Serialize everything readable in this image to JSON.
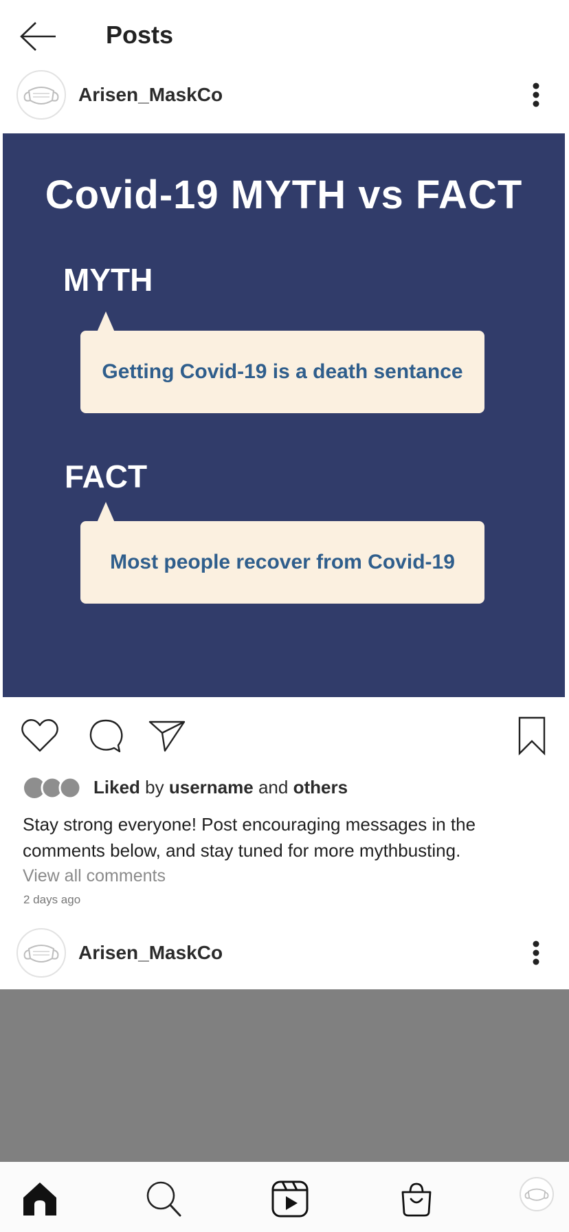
{
  "header": {
    "title": "Posts",
    "back_icon": "arrow-left-icon"
  },
  "post1": {
    "username": "Arisen_MaskCo",
    "avatar_icon": "face-mask-icon",
    "more_icon": "more-vertical-icon",
    "image": {
      "title": "Covid-19 MYTH vs FACT",
      "myth_label": "MYTH",
      "myth_text": "Getting Covid-19 is a death sentance",
      "fact_label": "FACT",
      "fact_text": "Most people recover from Covid-19",
      "background_color": "#313c6a",
      "bubble_color": "#fbf0e0",
      "bubble_text_color": "#2f5e8c"
    },
    "actions": {
      "like_icon": "heart-icon",
      "comment_icon": "comment-icon",
      "share_icon": "send-icon",
      "save_icon": "bookmark-icon"
    },
    "likes": {
      "liked": "Liked",
      "by": "by",
      "username": "username",
      "and": "and",
      "others": "others"
    },
    "caption": "Stay strong everyone! Post encouraging messages in the comments below, and stay tuned for more mythbusting.",
    "view_comments": "View all comments",
    "timestamp": "2 days ago"
  },
  "post2": {
    "username": "Arisen_MaskCo",
    "avatar_icon": "face-mask-icon",
    "more_icon": "more-vertical-icon"
  },
  "bottom_nav": {
    "items": [
      "home-icon",
      "search-icon",
      "reels-icon",
      "shop-icon",
      "profile-avatar"
    ]
  }
}
